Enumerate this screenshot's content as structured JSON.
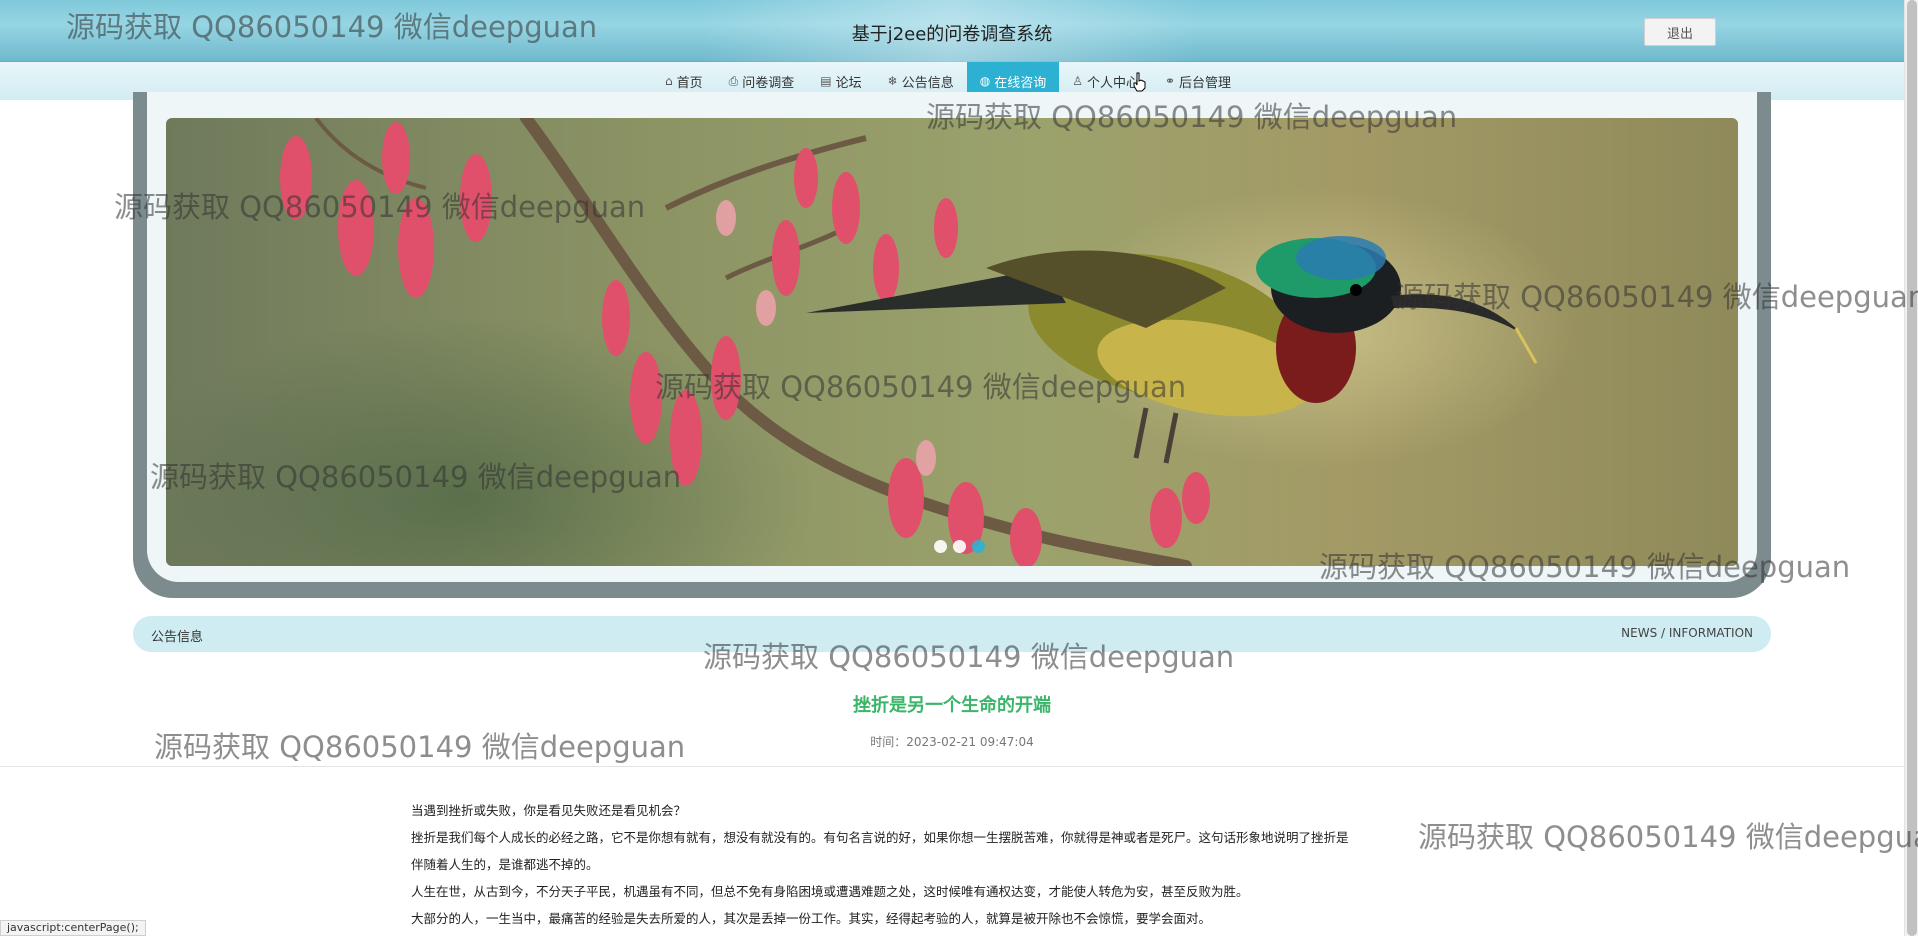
{
  "header": {
    "title": "基于j2ee的问卷调查系统",
    "logout_label": "退出"
  },
  "nav": {
    "items": [
      {
        "label": "首页",
        "icon": "home-icon"
      },
      {
        "label": "问卷调查",
        "icon": "print-icon"
      },
      {
        "label": "论坛",
        "icon": "forum-icon"
      },
      {
        "label": "公告信息",
        "icon": "snowflake-icon"
      },
      {
        "label": "在线咨询",
        "icon": "globe-icon"
      },
      {
        "label": "个人中心",
        "icon": "user-icon"
      },
      {
        "label": "后台管理",
        "icon": "link-icon"
      }
    ],
    "active_index": 4
  },
  "banner": {
    "slide_count": 3,
    "active_slide": 2
  },
  "section": {
    "title": "公告信息",
    "subtitle_en": "NEWS / INFORMATION"
  },
  "article": {
    "title": "挫折是另一个生命的开端",
    "time": "时间：2023-02-21 09:47:04",
    "paragraphs": [
      "当遇到挫折或失败，你是看见失败还是看见机会？",
      "挫折是我们每个人成长的必经之路，它不是你想有就有，想没有就没有的。有句名言说的好，如果你想一生摆脱苦难，你就得是神或者是死尸。这句话形象地说明了挫折是",
      "伴随着人生的，是谁都逃不掉的。",
      "人生在世，从古到今，不分天子平民，机遇虽有不同，但总不免有身陷困境或遭遇难题之处，这时候唯有通权达变，才能使人转危为安，甚至反败为胜。",
      "大部分的人，一生当中，最痛苦的经验是失去所爱的人，其次是丢掉一份工作。其实，经得起考验的人，就算是被开除也不会惊慌，要学会面对。"
    ]
  },
  "statusbar": {
    "text": "javascript:centerPage();"
  },
  "watermark": {
    "text": "源码获取 QQ86050149 微信deepguan"
  },
  "colors": {
    "accent": "#2db1d2",
    "article_title": "#3ab56a",
    "header_bg": "#7fc9db",
    "section_bar": "#cfecf2"
  }
}
